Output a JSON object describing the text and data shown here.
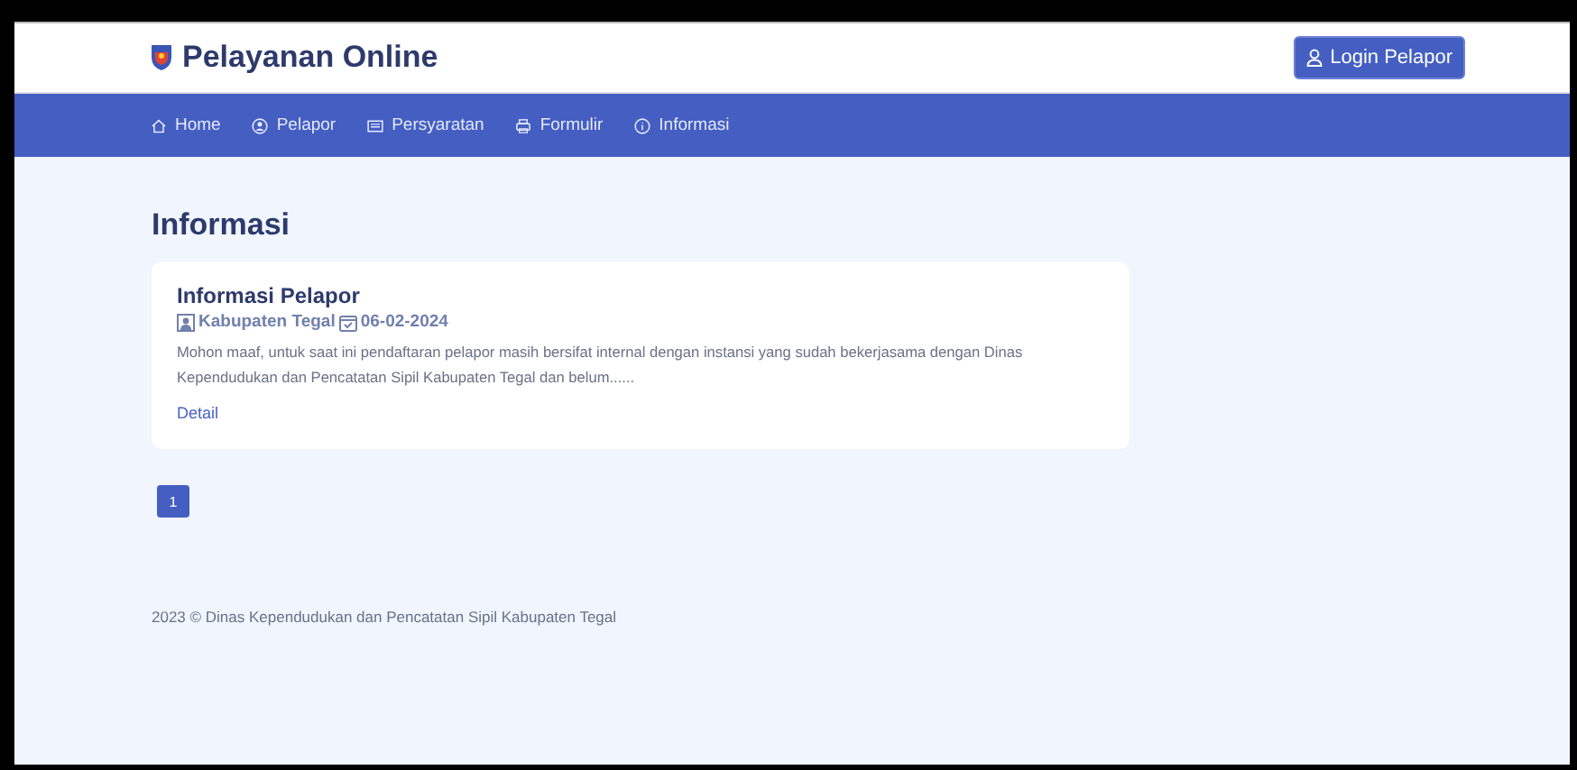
{
  "header": {
    "title": "Pelayanan Online",
    "login_button": "Login Pelapor"
  },
  "nav": [
    {
      "label": "Home",
      "kind": "home"
    },
    {
      "label": "Pelapor",
      "kind": "user"
    },
    {
      "label": "Persyaratan",
      "kind": "list"
    },
    {
      "label": "Formulir",
      "kind": "print"
    },
    {
      "label": "Informasi",
      "kind": "info"
    }
  ],
  "page_title": "Informasi",
  "posts": [
    {
      "title": "Informasi Pelapor",
      "author": "Kabupaten Tegal",
      "date": "06-02-2024",
      "excerpt": "Mohon maaf, untuk saat ini pendaftaran pelapor masih bersifat internal dengan instansi yang sudah bekerjasama dengan Dinas Kependudukan dan Pencatatan Sipil Kabupaten Tegal dan belum......",
      "link": "Detail"
    }
  ],
  "pagination": [
    {
      "label": "1",
      "selected": true
    }
  ],
  "footer": "2023 © Dinas Kependudukan dan Pencatatan Sipil Kabupaten Tegal"
}
